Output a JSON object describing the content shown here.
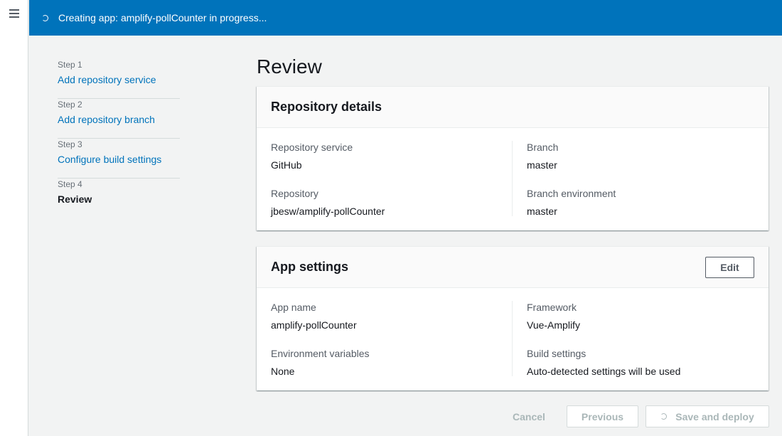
{
  "banner": {
    "message": "Creating app: amplify-pollCounter in progress..."
  },
  "steps": [
    {
      "step": "Step 1",
      "label": "Add repository service"
    },
    {
      "step": "Step 2",
      "label": "Add repository branch"
    },
    {
      "step": "Step 3",
      "label": "Configure build settings"
    },
    {
      "step": "Step 4",
      "label": "Review"
    }
  ],
  "page": {
    "title": "Review"
  },
  "repository_details": {
    "title": "Repository details",
    "fields": [
      {
        "key": "Repository service",
        "value": "GitHub"
      },
      {
        "key": "Repository",
        "value": "jbesw/amplify-pollCounter"
      },
      {
        "key": "Branch",
        "value": "master"
      },
      {
        "key": "Branch environment",
        "value": "master"
      }
    ]
  },
  "app_settings": {
    "title": "App settings",
    "edit_label": "Edit",
    "fields": [
      {
        "key": "App name",
        "value": "amplify-pollCounter"
      },
      {
        "key": "Environment variables",
        "value": "None"
      },
      {
        "key": "Framework",
        "value": "Vue-Amplify"
      },
      {
        "key": "Build settings",
        "value": "Auto-detected settings will be used"
      }
    ]
  },
  "actions": {
    "cancel": "Cancel",
    "previous": "Previous",
    "save_deploy": "Save and deploy"
  },
  "colors": {
    "banner": "#0073bb",
    "link": "#0073bb",
    "disabled": "#aab7b8"
  },
  "icons": {
    "menu": "hamburger-menu-icon",
    "loading": "spinner-icon"
  }
}
